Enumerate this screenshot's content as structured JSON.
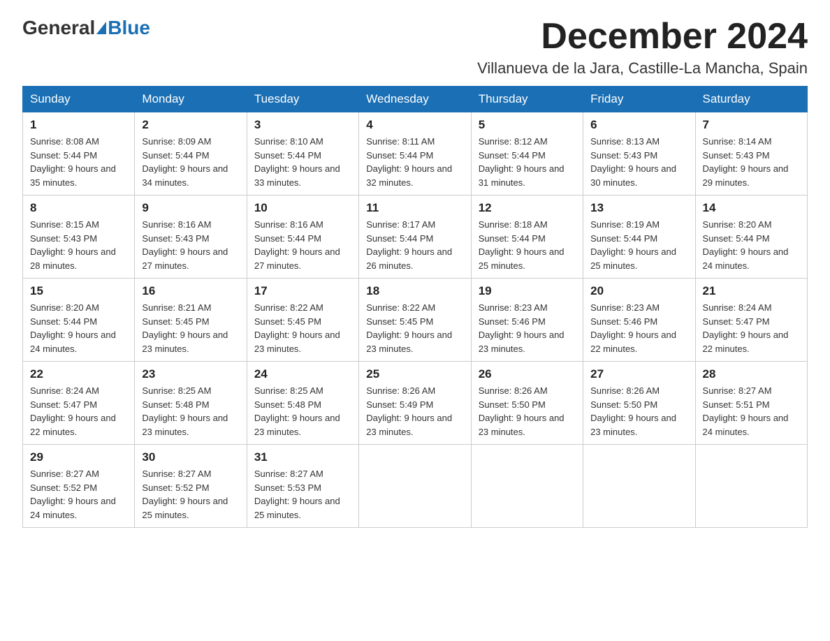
{
  "header": {
    "logo_general": "General",
    "logo_blue": "Blue",
    "month_title": "December 2024",
    "location": "Villanueva de la Jara, Castille-La Mancha, Spain"
  },
  "days_of_week": [
    "Sunday",
    "Monday",
    "Tuesday",
    "Wednesday",
    "Thursday",
    "Friday",
    "Saturday"
  ],
  "weeks": [
    [
      {
        "day": "1",
        "sunrise": "8:08 AM",
        "sunset": "5:44 PM",
        "daylight": "9 hours and 35 minutes."
      },
      {
        "day": "2",
        "sunrise": "8:09 AM",
        "sunset": "5:44 PM",
        "daylight": "9 hours and 34 minutes."
      },
      {
        "day": "3",
        "sunrise": "8:10 AM",
        "sunset": "5:44 PM",
        "daylight": "9 hours and 33 minutes."
      },
      {
        "day": "4",
        "sunrise": "8:11 AM",
        "sunset": "5:44 PM",
        "daylight": "9 hours and 32 minutes."
      },
      {
        "day": "5",
        "sunrise": "8:12 AM",
        "sunset": "5:44 PM",
        "daylight": "9 hours and 31 minutes."
      },
      {
        "day": "6",
        "sunrise": "8:13 AM",
        "sunset": "5:43 PM",
        "daylight": "9 hours and 30 minutes."
      },
      {
        "day": "7",
        "sunrise": "8:14 AM",
        "sunset": "5:43 PM",
        "daylight": "9 hours and 29 minutes."
      }
    ],
    [
      {
        "day": "8",
        "sunrise": "8:15 AM",
        "sunset": "5:43 PM",
        "daylight": "9 hours and 28 minutes."
      },
      {
        "day": "9",
        "sunrise": "8:16 AM",
        "sunset": "5:43 PM",
        "daylight": "9 hours and 27 minutes."
      },
      {
        "day": "10",
        "sunrise": "8:16 AM",
        "sunset": "5:44 PM",
        "daylight": "9 hours and 27 minutes."
      },
      {
        "day": "11",
        "sunrise": "8:17 AM",
        "sunset": "5:44 PM",
        "daylight": "9 hours and 26 minutes."
      },
      {
        "day": "12",
        "sunrise": "8:18 AM",
        "sunset": "5:44 PM",
        "daylight": "9 hours and 25 minutes."
      },
      {
        "day": "13",
        "sunrise": "8:19 AM",
        "sunset": "5:44 PM",
        "daylight": "9 hours and 25 minutes."
      },
      {
        "day": "14",
        "sunrise": "8:20 AM",
        "sunset": "5:44 PM",
        "daylight": "9 hours and 24 minutes."
      }
    ],
    [
      {
        "day": "15",
        "sunrise": "8:20 AM",
        "sunset": "5:44 PM",
        "daylight": "9 hours and 24 minutes."
      },
      {
        "day": "16",
        "sunrise": "8:21 AM",
        "sunset": "5:45 PM",
        "daylight": "9 hours and 23 minutes."
      },
      {
        "day": "17",
        "sunrise": "8:22 AM",
        "sunset": "5:45 PM",
        "daylight": "9 hours and 23 minutes."
      },
      {
        "day": "18",
        "sunrise": "8:22 AM",
        "sunset": "5:45 PM",
        "daylight": "9 hours and 23 minutes."
      },
      {
        "day": "19",
        "sunrise": "8:23 AM",
        "sunset": "5:46 PM",
        "daylight": "9 hours and 23 minutes."
      },
      {
        "day": "20",
        "sunrise": "8:23 AM",
        "sunset": "5:46 PM",
        "daylight": "9 hours and 22 minutes."
      },
      {
        "day": "21",
        "sunrise": "8:24 AM",
        "sunset": "5:47 PM",
        "daylight": "9 hours and 22 minutes."
      }
    ],
    [
      {
        "day": "22",
        "sunrise": "8:24 AM",
        "sunset": "5:47 PM",
        "daylight": "9 hours and 22 minutes."
      },
      {
        "day": "23",
        "sunrise": "8:25 AM",
        "sunset": "5:48 PM",
        "daylight": "9 hours and 23 minutes."
      },
      {
        "day": "24",
        "sunrise": "8:25 AM",
        "sunset": "5:48 PM",
        "daylight": "9 hours and 23 minutes."
      },
      {
        "day": "25",
        "sunrise": "8:26 AM",
        "sunset": "5:49 PM",
        "daylight": "9 hours and 23 minutes."
      },
      {
        "day": "26",
        "sunrise": "8:26 AM",
        "sunset": "5:50 PM",
        "daylight": "9 hours and 23 minutes."
      },
      {
        "day": "27",
        "sunrise": "8:26 AM",
        "sunset": "5:50 PM",
        "daylight": "9 hours and 23 minutes."
      },
      {
        "day": "28",
        "sunrise": "8:27 AM",
        "sunset": "5:51 PM",
        "daylight": "9 hours and 24 minutes."
      }
    ],
    [
      {
        "day": "29",
        "sunrise": "8:27 AM",
        "sunset": "5:52 PM",
        "daylight": "9 hours and 24 minutes."
      },
      {
        "day": "30",
        "sunrise": "8:27 AM",
        "sunset": "5:52 PM",
        "daylight": "9 hours and 25 minutes."
      },
      {
        "day": "31",
        "sunrise": "8:27 AM",
        "sunset": "5:53 PM",
        "daylight": "9 hours and 25 minutes."
      },
      null,
      null,
      null,
      null
    ]
  ]
}
